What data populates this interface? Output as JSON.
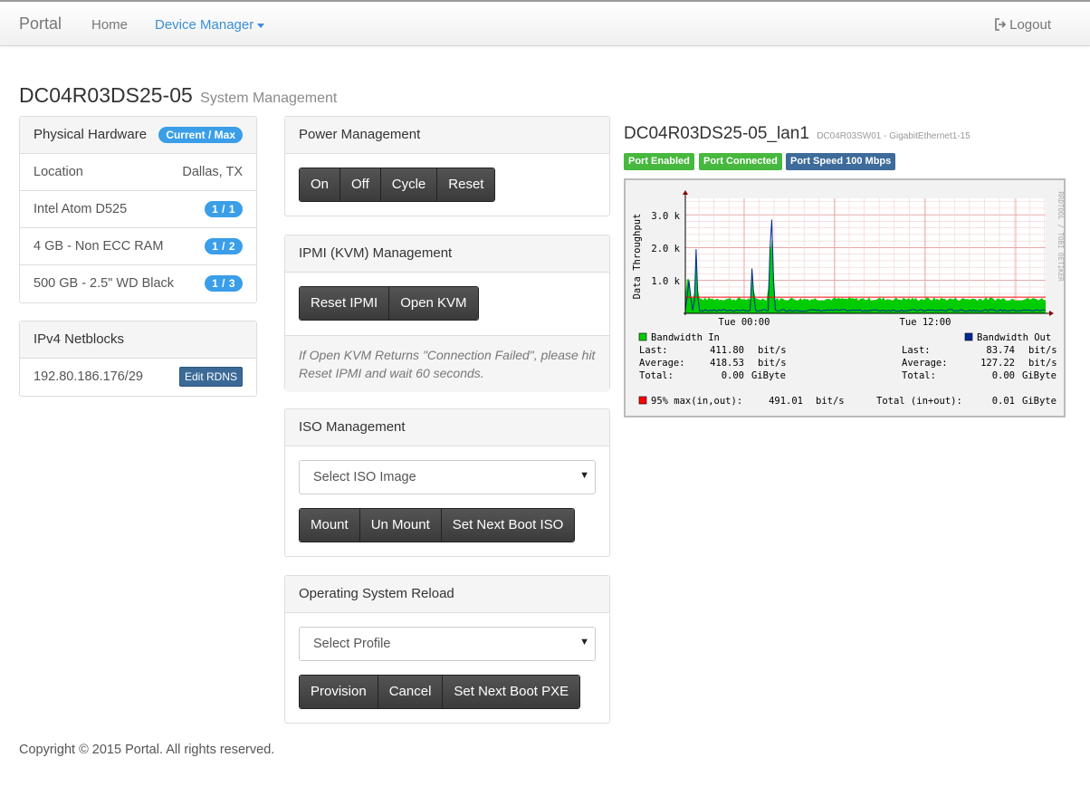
{
  "nav": {
    "brand": "Portal",
    "home": "Home",
    "device_manager": "Device Manager",
    "logout": "Logout"
  },
  "page": {
    "title": "DC04R03DS25-05",
    "subtitle": "System Management"
  },
  "hardware": {
    "heading": "Physical Hardware",
    "heading_badge": "Current / Max",
    "location_label": "Location",
    "location_value": "Dallas, TX",
    "items": [
      {
        "label": "Intel Atom D525",
        "badge": "1 / 1"
      },
      {
        "label": "4 GB - Non ECC RAM",
        "badge": "1 / 2"
      },
      {
        "label": "500 GB - 2.5\" WD Black",
        "badge": "1 / 3"
      }
    ]
  },
  "netblocks": {
    "heading": "IPv4 Netblocks",
    "items": [
      {
        "address": "192.80.186.176/29",
        "button": "Edit RDNS"
      }
    ]
  },
  "power": {
    "heading": "Power Management",
    "buttons": [
      "On",
      "Off",
      "Cycle",
      "Reset"
    ]
  },
  "ipmi": {
    "heading": "IPMI (KVM) Management",
    "buttons": [
      "Reset IPMI",
      "Open KVM"
    ],
    "note": "If Open KVM Returns \"Connection Failed\", please hit Reset IPMI and wait 60 seconds."
  },
  "iso": {
    "heading": "ISO Management",
    "select": "Select ISO Image",
    "buttons": [
      "Mount",
      "Un Mount",
      "Set Next Boot ISO"
    ]
  },
  "os_reload": {
    "heading": "Operating System Reload",
    "select": "Select Profile",
    "buttons": [
      "Provision",
      "Cancel",
      "Set Next Boot PXE"
    ]
  },
  "port": {
    "title": "DC04R03DS25-05_lan1",
    "subtitle": "DC04R03SW01 - GigabitEthernet1-15",
    "labels": [
      "Port Enabled",
      "Port Connected",
      "Port Speed 100 Mbps"
    ]
  },
  "graph": {
    "ylabel": "Data Throughput",
    "yticks": [
      "3.0 k",
      "2.0 k",
      "1.0 k"
    ],
    "xticks": [
      "Tue 00:00",
      "Tue 12:00"
    ],
    "watermark": "RRDTOOL / TOBI OETIKER",
    "in": {
      "name": "Bandwidth In",
      "last_label": "Last:",
      "last": "411.80",
      "avg_label": "Average:",
      "avg": "418.53",
      "unit": "bit/s",
      "total_label": "Total:",
      "total": "0.00",
      "total_unit": "GiByte",
      "color": "#00cc00"
    },
    "out": {
      "name": "Bandwidth Out",
      "last_label": "Last:",
      "last": "83.74",
      "avg_label": "Average:",
      "avg": "127.22",
      "unit": "bit/s",
      "total_label": "Total:",
      "total": "0.00",
      "total_unit": "GiByte",
      "color": "#002a97"
    },
    "p95_label": "95% max(in,out):",
    "p95_value": "491.01",
    "p95_unit": "bit/s",
    "p95_color": "#ff0000",
    "total_label": "Total (in+out):",
    "total_value": "0.01",
    "total_unit": "GiByte"
  },
  "footer": "Copyright © 2015 Portal. All rights reserved."
}
